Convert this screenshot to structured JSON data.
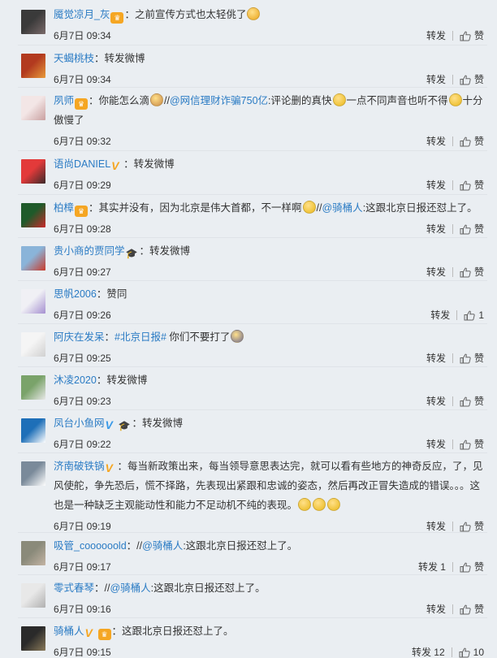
{
  "comments": [
    {
      "nick": "魇觉凉月_灰",
      "badges": [
        "vip"
      ],
      "segments": [
        {
          "t": "text",
          "v": "：之前宣传方式也太轻佻了"
        },
        {
          "t": "emoji",
          "v": "#f0b63b"
        }
      ],
      "time": "6月7日 09:34",
      "repost": "转发",
      "like": "赞",
      "avatar": [
        "#3a3a3a",
        "#7a6a6a"
      ]
    },
    {
      "nick": "天蝎桃枝",
      "badges": [],
      "segments": [
        {
          "t": "text",
          "v": "：转发微博"
        }
      ],
      "time": "6月7日 09:34",
      "repost": "转发",
      "like": "赞",
      "avatar": [
        "#b23a1f",
        "#e89a3a"
      ]
    },
    {
      "nick": "夙师",
      "badges": [
        "vip"
      ],
      "segments": [
        {
          "t": "text",
          "v": "：你能怎么滴"
        },
        {
          "t": "emoji",
          "v": "#d9a35a"
        },
        {
          "t": "text",
          "v": "//"
        },
        {
          "t": "link",
          "v": "@网信理财诈骗750亿"
        },
        {
          "t": "text",
          "v": ":评论删的真快"
        },
        {
          "t": "emoji",
          "v": "#f0c43b"
        },
        {
          "t": "text",
          "v": "一点不同声音也听不得"
        },
        {
          "t": "emoji",
          "v": "#f0c43b"
        },
        {
          "t": "text",
          "v": "十分傲慢了"
        }
      ],
      "time": "6月7日 09:32",
      "repost": "转发",
      "like": "赞",
      "avatar": [
        "#f3e6e6",
        "#c9a0a0"
      ]
    },
    {
      "nick": "语尚DANIEL",
      "badges": [
        "v"
      ],
      "segments": [
        {
          "t": "text",
          "v": "：转发微博"
        }
      ],
      "time": "6月7日 09:29",
      "repost": "转发",
      "like": "赞",
      "avatar": [
        "#e33a3a",
        "#3a2a2a"
      ]
    },
    {
      "nick": "柏樟",
      "badges": [
        "vip"
      ],
      "segments": [
        {
          "t": "text",
          "v": "：其实并没有，因为北京是伟大首都，不一样啊"
        },
        {
          "t": "emoji",
          "v": "#f0c43b"
        },
        {
          "t": "text",
          "v": "//"
        },
        {
          "t": "link",
          "v": "@骑桶人"
        },
        {
          "t": "text",
          "v": ":这跟北京日报还怼上了。"
        }
      ],
      "time": "6月7日 09:28",
      "repost": "转发",
      "like": "赞",
      "avatar": [
        "#1f5a2a",
        "#c92a2a"
      ]
    },
    {
      "nick": "贵小商的贾同学",
      "badges": [
        "cap"
      ],
      "segments": [
        {
          "t": "text",
          "v": "：转发微博"
        }
      ],
      "time": "6月7日 09:27",
      "repost": "转发",
      "like": "赞",
      "avatar": [
        "#8ab4d9",
        "#c93a2a"
      ]
    },
    {
      "nick": "思帆2006",
      "badges": [],
      "segments": [
        {
          "t": "text",
          "v": "：赞同"
        }
      ],
      "time": "6月7日 09:26",
      "repost": "转发",
      "like": "1",
      "avatar": [
        "#f0f0f5",
        "#a58fd0"
      ]
    },
    {
      "nick": "阿庆在发呆",
      "badges": [],
      "segments": [
        {
          "t": "text",
          "v": "："
        },
        {
          "t": "link",
          "v": "#北京日报#"
        },
        {
          "t": "text",
          "v": " 你们不要打了"
        },
        {
          "t": "emoji",
          "v": "#9a8f8f"
        }
      ],
      "time": "6月7日 09:25",
      "repost": "转发",
      "like": "赞",
      "avatar": [
        "#f5f5f5",
        "#d0d0d0"
      ]
    },
    {
      "nick": "沐凌2020",
      "badges": [],
      "segments": [
        {
          "t": "text",
          "v": "：转发微博"
        }
      ],
      "time": "6月7日 09:23",
      "repost": "转发",
      "like": "赞",
      "avatar": [
        "#7aa36a",
        "#e8e8e8"
      ]
    },
    {
      "nick": "凤台小鱼网",
      "badges": [
        "vblue",
        "cap"
      ],
      "segments": [
        {
          "t": "text",
          "v": "：转发微博"
        }
      ],
      "time": "6月7日 09:22",
      "repost": "转发",
      "like": "赞",
      "avatar": [
        "#1e6fb8",
        "#ffffff"
      ]
    },
    {
      "nick": "济南破铁锅",
      "badges": [
        "v"
      ],
      "segments": [
        {
          "t": "text",
          "v": "：每当新政策出来，每当领导意思表达完，就可以看有些地方的神奇反应，了，见风使舵，争先恐后，慌不择路，先表现出紧跟和忠诚的姿态，然后再改正冒失造成的错误。。。这也是一种缺乏主观能动性和能力不足动机不纯的表现。"
        },
        {
          "t": "emoji",
          "v": "#f0c43b"
        },
        {
          "t": "emoji",
          "v": "#f0c43b"
        },
        {
          "t": "emoji",
          "v": "#f0c43b"
        }
      ],
      "time": "6月7日 09:19",
      "repost": "转发",
      "like": "赞",
      "avatar": [
        "#7a8a9a",
        "#ffffff"
      ]
    },
    {
      "nick": "吸管_coooooold",
      "badges": [],
      "segments": [
        {
          "t": "text",
          "v": "：//"
        },
        {
          "t": "link",
          "v": "@骑桶人"
        },
        {
          "t": "text",
          "v": ":这跟北京日报还怼上了。"
        }
      ],
      "time": "6月7日 09:17",
      "repost": "转发 1",
      "like": "赞",
      "avatar": [
        "#8a8a7a",
        "#c4b4a4"
      ]
    },
    {
      "nick": "零式春琴",
      "badges": [],
      "segments": [
        {
          "t": "text",
          "v": "：//"
        },
        {
          "t": "link",
          "v": "@骑桶人"
        },
        {
          "t": "text",
          "v": ":这跟北京日报还怼上了。"
        }
      ],
      "time": "6月7日 09:16",
      "repost": "转发",
      "like": "赞",
      "avatar": [
        "#e8e8e8",
        "#b0b0b0"
      ]
    },
    {
      "nick": "骑桶人",
      "badges": [
        "v",
        "vip"
      ],
      "segments": [
        {
          "t": "text",
          "v": "：这跟北京日报还怼上了。"
        }
      ],
      "time": "6月7日 09:15",
      "repost": "转发 12",
      "like": "10",
      "avatar": [
        "#2a2a2a",
        "#8a7a5a"
      ]
    }
  ]
}
